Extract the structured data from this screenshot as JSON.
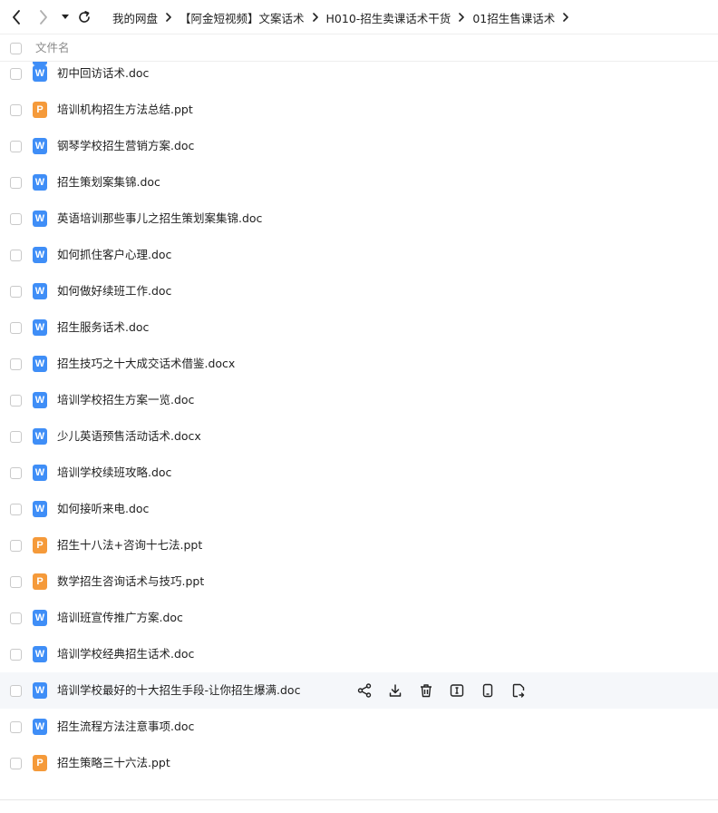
{
  "nav": {
    "back_icon": "chevron-left-icon",
    "forward_icon": "chevron-right-icon",
    "history_icon": "caret-down-icon",
    "refresh_icon": "refresh-icon"
  },
  "breadcrumb": [
    "我的网盘",
    "【阿金短视频】文案话术",
    "H010-招生卖课话术干货",
    "01招生售课话术"
  ],
  "list_header": {
    "name_label": "文件名"
  },
  "files": [
    {
      "name": "初中回访话术.doc",
      "type": "word",
      "badge": "W"
    },
    {
      "name": "培训机构招生方法总结.ppt",
      "type": "ppt",
      "badge": "P"
    },
    {
      "name": "钢琴学校招生营销方案.doc",
      "type": "word",
      "badge": "W"
    },
    {
      "name": "招生策划案集锦.doc",
      "type": "word",
      "badge": "W"
    },
    {
      "name": "英语培训那些事儿之招生策划案集锦.doc",
      "type": "word",
      "badge": "W"
    },
    {
      "name": "如何抓住客户心理.doc",
      "type": "word",
      "badge": "W"
    },
    {
      "name": "如何做好续班工作.doc",
      "type": "word",
      "badge": "W"
    },
    {
      "name": "招生服务话术.doc",
      "type": "word",
      "badge": "W"
    },
    {
      "name": "招生技巧之十大成交话术借鉴.docx",
      "type": "word",
      "badge": "W"
    },
    {
      "name": "培训学校招生方案一览.doc",
      "type": "word",
      "badge": "W"
    },
    {
      "name": "少儿英语预售活动话术.docx",
      "type": "word",
      "badge": "W"
    },
    {
      "name": "培训学校续班攻略.doc",
      "type": "word",
      "badge": "W"
    },
    {
      "name": "如何接听来电.doc",
      "type": "word",
      "badge": "W"
    },
    {
      "name": "招生十八法+咨询十七法.ppt",
      "type": "ppt",
      "badge": "P"
    },
    {
      "name": "数学招生咨询话术与技巧.ppt",
      "type": "ppt",
      "badge": "P"
    },
    {
      "name": "培训班宣传推广方案.doc",
      "type": "word",
      "badge": "W"
    },
    {
      "name": "培训学校经典招生话术.doc",
      "type": "word",
      "badge": "W"
    },
    {
      "name": "培训学校最好的十大招生手段-让你招生爆满.doc",
      "type": "word",
      "badge": "W",
      "hovered": true
    },
    {
      "name": "招生流程方法注意事项.doc",
      "type": "word",
      "badge": "W"
    },
    {
      "name": "招生策略三十六法.ppt",
      "type": "ppt",
      "badge": "P"
    }
  ],
  "row_actions": [
    "share-icon",
    "download-icon",
    "delete-icon",
    "rename-icon",
    "view-on-phone-icon",
    "copy-link-icon"
  ],
  "colors": {
    "word": "#3f8ef7",
    "ppt": "#f59a3a",
    "hover_bg": "#f5f7fa",
    "divider": "#eeeeee"
  }
}
